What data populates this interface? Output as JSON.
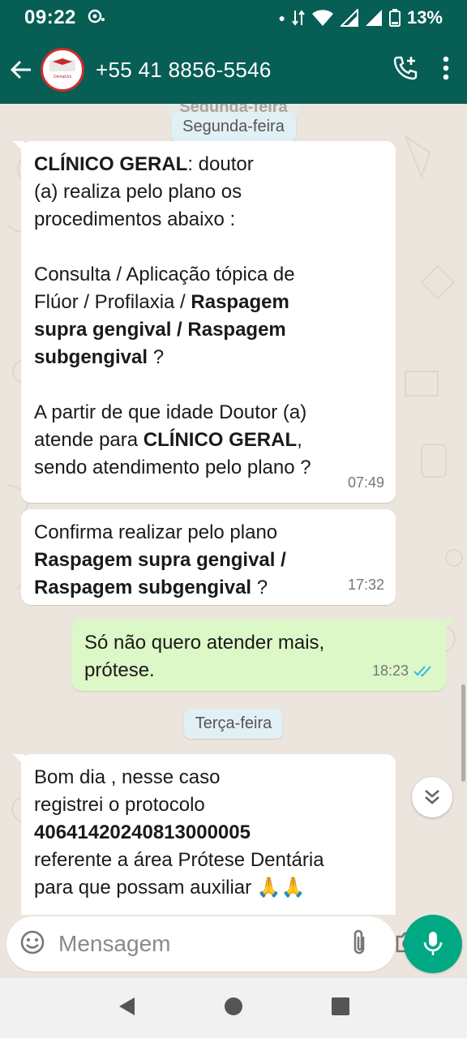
{
  "status_bar": {
    "time": "09:22",
    "battery_percent": "13%"
  },
  "header": {
    "contact_name": "+55 41 8856-5546",
    "avatar_logo_text": "DentalUni"
  },
  "chat": {
    "date_chip_partial": "Segunda-feira",
    "date_chip_monday": "Segunda-feira",
    "date_chip_tuesday": "Terça-feira",
    "messages": [
      {
        "direction": "incoming",
        "time": "07:49",
        "lines": [
          {
            "segments": [
              {
                "text": "CLÍNICO GERAL",
                "bold": true
              },
              {
                "text": ":  doutor",
                "bold": false
              }
            ]
          },
          {
            "segments": [
              {
                "text": "(a) realiza pelo plano os",
                "bold": false
              }
            ]
          },
          {
            "segments": [
              {
                "text": "procedimentos abaixo :",
                "bold": false
              }
            ]
          },
          {
            "segments": []
          },
          {
            "segments": [
              {
                "text": "Consulta /  Aplicação tópica de",
                "bold": false
              }
            ]
          },
          {
            "segments": [
              {
                "text": "Flúor  /  Profilaxia / ",
                "bold": false
              },
              {
                "text": "Raspagem",
                "bold": true
              }
            ]
          },
          {
            "segments": [
              {
                "text": "supra gengival / Raspagem",
                "bold": true
              }
            ]
          },
          {
            "segments": [
              {
                "text": "subgengival",
                "bold": true
              },
              {
                "text": " ?",
                "bold": false
              }
            ]
          },
          {
            "segments": []
          },
          {
            "segments": [
              {
                "text": " A partir de que idade Doutor (a)",
                "bold": false
              }
            ]
          },
          {
            "segments": [
              {
                "text": "atende para ",
                "bold": false
              },
              {
                "text": "CLÍNICO GERAL",
                "bold": true
              },
              {
                "text": ",",
                "bold": false
              }
            ]
          },
          {
            "segments": [
              {
                "text": "sendo atendimento pelo plano ?",
                "bold": false
              }
            ]
          }
        ]
      },
      {
        "direction": "incoming",
        "time": "17:32",
        "lines": [
          {
            "segments": [
              {
                "text": "Confirma realizar pelo plano",
                "bold": false
              }
            ]
          },
          {
            "segments": [
              {
                "text": "Raspagem supra gengival /",
                "bold": true
              }
            ]
          },
          {
            "segments": [
              {
                "text": "Raspagem subgengival",
                "bold": true
              },
              {
                "text": " ?",
                "bold": false
              }
            ]
          }
        ]
      },
      {
        "direction": "outgoing",
        "time": "18:23",
        "lines": [
          {
            "segments": [
              {
                "text": "Só não quero atender mais,",
                "bold": false
              }
            ]
          },
          {
            "segments": [
              {
                "text": "prótese.",
                "bold": false
              }
            ]
          }
        ]
      },
      {
        "direction": "incoming",
        "time": "",
        "lines": [
          {
            "segments": [
              {
                "text": "Bom dia , nesse caso",
                "bold": false
              }
            ]
          },
          {
            "segments": [
              {
                "text": "registrei o protocolo",
                "bold": false
              }
            ]
          },
          {
            "segments": [
              {
                "text": "40641420240813000005",
                "bold": true
              }
            ]
          },
          {
            "segments": [
              {
                "text": "referente a área Prótese Dentária",
                "bold": false
              }
            ]
          },
          {
            "segments": [
              {
                "text": "para que possam auxiliar 🙏🙏",
                "bold": false
              }
            ]
          }
        ]
      }
    ]
  },
  "composer": {
    "placeholder": "Mensagem"
  },
  "icons": {
    "back": "arrow-left-icon",
    "call": "add-call-icon",
    "menu": "more-vert-icon",
    "emoji": "emoji-icon",
    "attach": "paperclip-icon",
    "camera": "camera-icon",
    "mic": "mic-icon",
    "read_receipt": "double-check-icon",
    "scroll": "chevron-double-down-icon"
  },
  "colors": {
    "header": "#075E54",
    "chat_bg": "#ECE5DD",
    "outgoing": "#DCF8C6",
    "accent": "#00A884",
    "read_tick": "#34B7F1"
  }
}
